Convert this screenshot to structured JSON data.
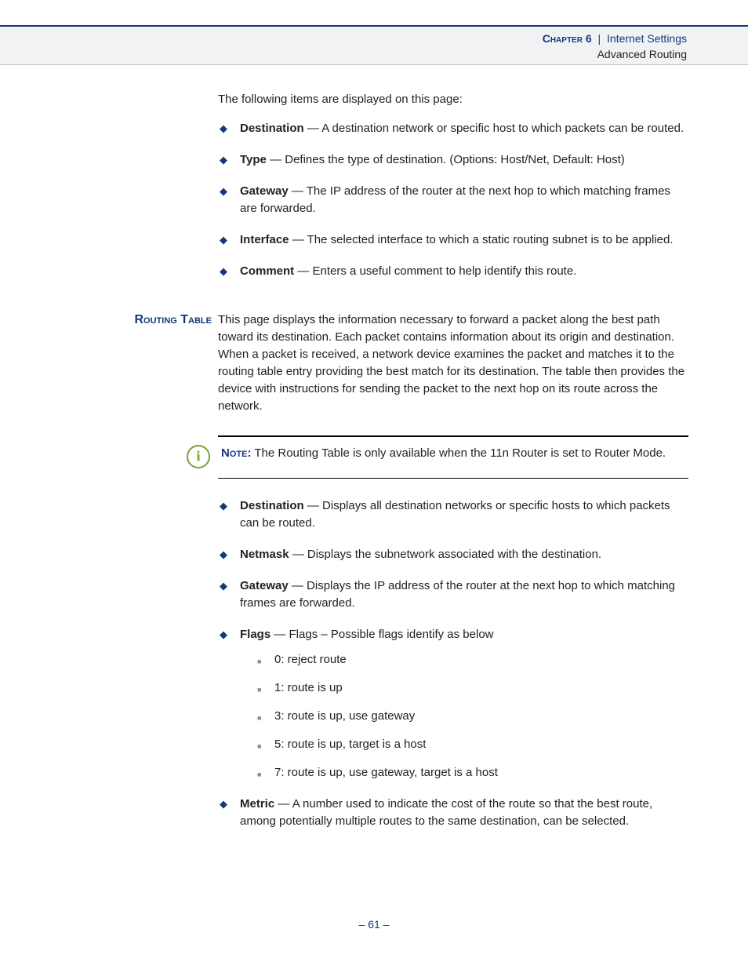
{
  "header": {
    "chapter_label": "Chapter 6",
    "separator": "|",
    "section": "Internet Settings",
    "subsection": "Advanced Routing"
  },
  "intro": "The following items are displayed on this page:",
  "list1": [
    {
      "term": "Destination",
      "desc": " — A destination network or specific host to which packets can be routed."
    },
    {
      "term": "Type",
      "desc": " — Defines the type of destination. (Options: Host/Net, Default: Host)"
    },
    {
      "term": "Gateway",
      "desc": " — The IP address of the router at the next hop to which matching frames are forwarded."
    },
    {
      "term": "Interface",
      "desc": " — The selected interface to which a static routing subnet is to be applied."
    },
    {
      "term": "Comment",
      "desc": " — Enters a useful comment to help identify this route."
    }
  ],
  "routing": {
    "side_head": "Routing Table",
    "para": "This page displays the information necessary to forward a packet along the best path toward its destination. Each packet contains information about its origin and destination. When a packet is received, a network device examines the packet and matches it to the routing table entry providing the best match for its destination. The table then provides the device with instructions for sending the packet to the next hop on its route across the network."
  },
  "note": {
    "label": "Note:",
    "text": " The Routing Table is only available when the 11n Router is set to Router Mode."
  },
  "list2": [
    {
      "term": "Destination",
      "desc": " — Displays all destination networks or specific hosts to which packets can be routed."
    },
    {
      "term": "Netmask",
      "desc": " — Displays the subnetwork associated with the destination."
    },
    {
      "term": "Gateway",
      "desc": " — Displays the IP address of the router at the next hop to which matching frames are forwarded."
    },
    {
      "term": "Flags",
      "desc": " — Flags – Possible flags identify as below"
    },
    {
      "term": "Metric",
      "desc": " — A number used to indicate the cost of the route so that the best route, among potentially multiple routes to the same destination, can be selected."
    }
  ],
  "flags": [
    "0: reject route",
    "1: route is up",
    "3: route is up, use gateway",
    "5: route is up, target is a host",
    "7: route is up, use gateway, target is a host"
  ],
  "page": {
    "prefix": "– ",
    "num": "61",
    "suffix": " –"
  }
}
